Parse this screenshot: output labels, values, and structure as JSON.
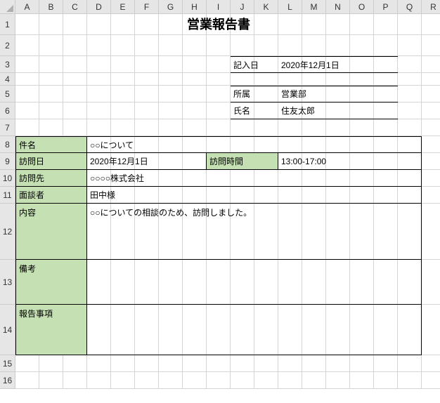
{
  "columns": [
    "A",
    "B",
    "C",
    "D",
    "E",
    "F",
    "G",
    "H",
    "I",
    "J",
    "K",
    "L",
    "M",
    "N",
    "O",
    "P",
    "Q",
    "R"
  ],
  "rows": [
    "1",
    "2",
    "3",
    "4",
    "5",
    "6",
    "7",
    "8",
    "9",
    "10",
    "11",
    "12",
    "13",
    "14",
    "15",
    "16"
  ],
  "title": "営業報告書",
  "header": {
    "date_label": "記入日",
    "date_value": "2020年12月1日",
    "dept_label": "所属",
    "dept_value": "営業部",
    "name_label": "氏名",
    "name_value": "住友太郎"
  },
  "form": {
    "subject_label": "件名",
    "subject_value": "○○について",
    "visit_date_label": "訪問日",
    "visit_date_value": "2020年12月1日",
    "visit_time_label": "訪問時間",
    "visit_time_value": "13:00-17:00",
    "destination_label": "訪問先",
    "destination_value": "○○○○株式会社",
    "interviewee_label": "面談者",
    "interviewee_value": "田中様",
    "content_label": "内容",
    "content_value": "○○についての相談のため、訪問しました。",
    "remarks_label": "備考",
    "remarks_value": "",
    "report_label": "報告事項",
    "report_value": ""
  },
  "colors": {
    "label_bg": "#c5e0b3",
    "header_bg": "#e6e6e6",
    "gridline": "#d4d4d4"
  }
}
